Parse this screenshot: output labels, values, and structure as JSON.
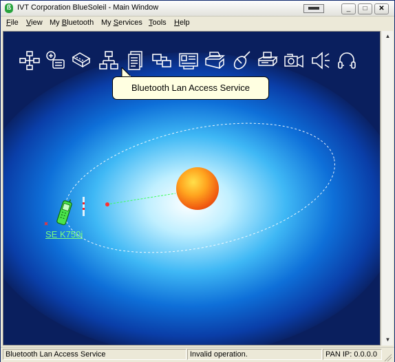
{
  "window": {
    "title": "IVT Corporation BlueSoleil - Main Window",
    "min_symbol": "_",
    "max_symbol": "□",
    "close_symbol": "✕"
  },
  "menu": [
    {
      "accel": "F",
      "rest": "ile"
    },
    {
      "accel": "V",
      "rest": "iew"
    },
    {
      "pre": "My ",
      "accel": "B",
      "rest": "luetooth"
    },
    {
      "pre": "My ",
      "accel": "S",
      "rest": "ervices"
    },
    {
      "accel": "T",
      "rest": "ools"
    },
    {
      "accel": "H",
      "rest": "elp"
    }
  ],
  "services": [
    {
      "icon": "network-hub-icon"
    },
    {
      "icon": "fax-dialup-icon"
    },
    {
      "icon": "serial-port-icon"
    },
    {
      "icon": "lan-access-icon"
    },
    {
      "icon": "file-transfer-icon"
    },
    {
      "icon": "synchronization-icon"
    },
    {
      "icon": "business-card-icon"
    },
    {
      "icon": "printer-icon"
    },
    {
      "icon": "mouse-icon"
    },
    {
      "icon": "fax-icon"
    },
    {
      "icon": "camera-icon"
    },
    {
      "icon": "speaker-icon"
    },
    {
      "icon": "headset-icon"
    }
  ],
  "tooltip": "Bluetooth Lan Access Service",
  "device": {
    "label": "SE K750i",
    "icon": "mobile-phone-icon"
  },
  "status": {
    "service": "Bluetooth Lan Access Service",
    "message": "Invalid operation.",
    "pan_ip": "PAN IP: 0.0.0.0"
  },
  "colors": {
    "canvas_bg": "#0a1f5e",
    "icon_stroke": "#ffffff",
    "device_label": "#7dff7d",
    "tooltip_bg": "#ffffe1"
  }
}
